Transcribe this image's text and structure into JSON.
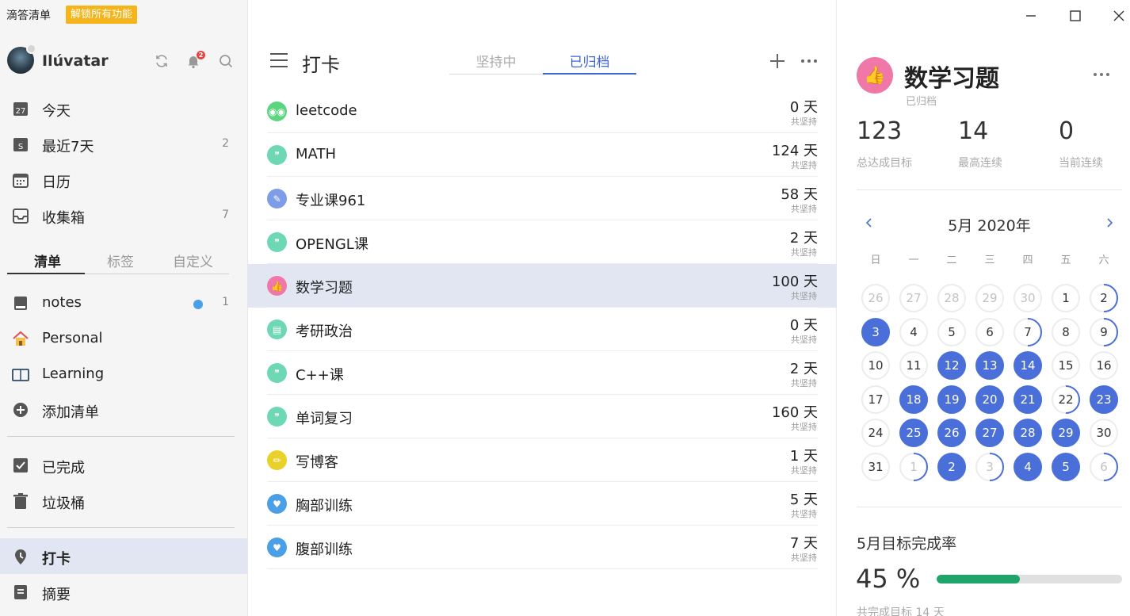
{
  "app": {
    "title": "滴答清单",
    "unlock_label": "解锁所有功能"
  },
  "user": {
    "name": "Ilúvatar",
    "notifications": "2"
  },
  "sidebar": {
    "smart_lists": [
      {
        "label": "今天",
        "count": "",
        "icon": "calendar-today-icon"
      },
      {
        "label": "最近7天",
        "count": "2",
        "icon": "calendar-week-icon"
      },
      {
        "label": "日历",
        "count": "",
        "icon": "calendar-icon"
      },
      {
        "label": "收集箱",
        "count": "7",
        "icon": "inbox-icon"
      }
    ],
    "tabs": [
      {
        "label": "清单"
      },
      {
        "label": "标签"
      },
      {
        "label": "自定义"
      }
    ],
    "lists": [
      {
        "label": "notes",
        "count": "1",
        "icon": "book-icon"
      },
      {
        "label": "Personal",
        "count": "",
        "icon": "home-icon"
      },
      {
        "label": "Learning",
        "count": "",
        "icon": "open-book-icon"
      },
      {
        "label": "添加清单",
        "count": "",
        "icon": "plus-circle-icon"
      }
    ],
    "system": [
      {
        "label": "已完成",
        "icon": "checkbox-icon"
      },
      {
        "label": "垃圾桶",
        "icon": "trash-icon"
      }
    ],
    "features": [
      {
        "label": "打卡",
        "icon": "habit-icon"
      },
      {
        "label": "摘要",
        "icon": "summary-icon"
      }
    ]
  },
  "habits_panel": {
    "title": "打卡",
    "tabs": [
      {
        "label": "坚持中"
      },
      {
        "label": "已归档"
      }
    ],
    "active_tab": 1,
    "items": [
      {
        "name": "leetcode",
        "days": "0 天",
        "sub": "共坚持",
        "color": "#5bd67f",
        "glyph": "◉◉"
      },
      {
        "name": "MATH",
        "days": "124 天",
        "sub": "共坚持",
        "color": "#6ed8b4",
        "glyph": "❞"
      },
      {
        "name": "专业课961",
        "days": "58 天",
        "sub": "共坚持",
        "color": "#7e9de8",
        "glyph": "✎"
      },
      {
        "name": "OPENGL课",
        "days": "2 天",
        "sub": "共坚持",
        "color": "#6ed8b4",
        "glyph": "❞"
      },
      {
        "name": "数学习题",
        "days": "100 天",
        "sub": "共坚持",
        "color": "#f078a8",
        "glyph": "👍"
      },
      {
        "name": "考研政治",
        "days": "0 天",
        "sub": "共坚持",
        "color": "#6ed8b4",
        "glyph": "▤"
      },
      {
        "name": "C++课",
        "days": "2 天",
        "sub": "共坚持",
        "color": "#6ed8b4",
        "glyph": "❞"
      },
      {
        "name": "单词复习",
        "days": "160 天",
        "sub": "共坚持",
        "color": "#6ed8b4",
        "glyph": "❞"
      },
      {
        "name": "写博客",
        "days": "1 天",
        "sub": "共坚持",
        "color": "#e8d22a",
        "glyph": "✏"
      },
      {
        "name": "胸部训练",
        "days": "5 天",
        "sub": "共坚持",
        "color": "#4a9fe6",
        "glyph": "♥"
      },
      {
        "name": "腹部训练",
        "days": "7 天",
        "sub": "共坚持",
        "color": "#4a9fe6",
        "glyph": "♥"
      }
    ],
    "selected_index": 4
  },
  "detail": {
    "title": "数学习题",
    "status": "已归档",
    "stats": [
      {
        "value": "123",
        "label": "总达成目标"
      },
      {
        "value": "14",
        "label": "最高连续"
      },
      {
        "value": "0",
        "label": "当前连续"
      }
    ],
    "calendar": {
      "title": "5月 2020年",
      "weekdays": [
        "日",
        "一",
        "二",
        "三",
        "四",
        "五",
        "六"
      ],
      "days": [
        {
          "d": "26",
          "out": true,
          "state": "none"
        },
        {
          "d": "27",
          "out": true,
          "state": "none"
        },
        {
          "d": "28",
          "out": true,
          "state": "none"
        },
        {
          "d": "29",
          "out": true,
          "state": "none"
        },
        {
          "d": "30",
          "out": true,
          "state": "none"
        },
        {
          "d": "1",
          "out": false,
          "state": "none"
        },
        {
          "d": "2",
          "out": false,
          "state": "partial"
        },
        {
          "d": "3",
          "out": false,
          "state": "full"
        },
        {
          "d": "4",
          "out": false,
          "state": "none"
        },
        {
          "d": "5",
          "out": false,
          "state": "none"
        },
        {
          "d": "6",
          "out": false,
          "state": "none"
        },
        {
          "d": "7",
          "out": false,
          "state": "partial"
        },
        {
          "d": "8",
          "out": false,
          "state": "none"
        },
        {
          "d": "9",
          "out": false,
          "state": "partial"
        },
        {
          "d": "10",
          "out": false,
          "state": "none"
        },
        {
          "d": "11",
          "out": false,
          "state": "none"
        },
        {
          "d": "12",
          "out": false,
          "state": "full"
        },
        {
          "d": "13",
          "out": false,
          "state": "full"
        },
        {
          "d": "14",
          "out": false,
          "state": "full"
        },
        {
          "d": "15",
          "out": false,
          "state": "none"
        },
        {
          "d": "16",
          "out": false,
          "state": "none"
        },
        {
          "d": "17",
          "out": false,
          "state": "none"
        },
        {
          "d": "18",
          "out": false,
          "state": "full"
        },
        {
          "d": "19",
          "out": false,
          "state": "full"
        },
        {
          "d": "20",
          "out": false,
          "state": "full"
        },
        {
          "d": "21",
          "out": false,
          "state": "full"
        },
        {
          "d": "22",
          "out": false,
          "state": "partial"
        },
        {
          "d": "23",
          "out": false,
          "state": "full"
        },
        {
          "d": "24",
          "out": false,
          "state": "none"
        },
        {
          "d": "25",
          "out": false,
          "state": "full"
        },
        {
          "d": "26",
          "out": false,
          "state": "full"
        },
        {
          "d": "27",
          "out": false,
          "state": "full"
        },
        {
          "d": "28",
          "out": false,
          "state": "full"
        },
        {
          "d": "29",
          "out": false,
          "state": "full"
        },
        {
          "d": "30",
          "out": false,
          "state": "none"
        },
        {
          "d": "31",
          "out": false,
          "state": "none"
        },
        {
          "d": "1",
          "out": true,
          "state": "partial"
        },
        {
          "d": "2",
          "out": true,
          "state": "full"
        },
        {
          "d": "3",
          "out": true,
          "state": "partial"
        },
        {
          "d": "4",
          "out": true,
          "state": "full"
        },
        {
          "d": "5",
          "out": true,
          "state": "full"
        },
        {
          "d": "6",
          "out": true,
          "state": "partial"
        }
      ]
    },
    "monthly_rate": {
      "title": "5月目标完成率",
      "value": "45 %",
      "fraction": 0.45,
      "footer": "共完成目标 14 天"
    },
    "colors": {
      "accent": "#4a6fd8",
      "progress": "#1fa56c"
    }
  }
}
